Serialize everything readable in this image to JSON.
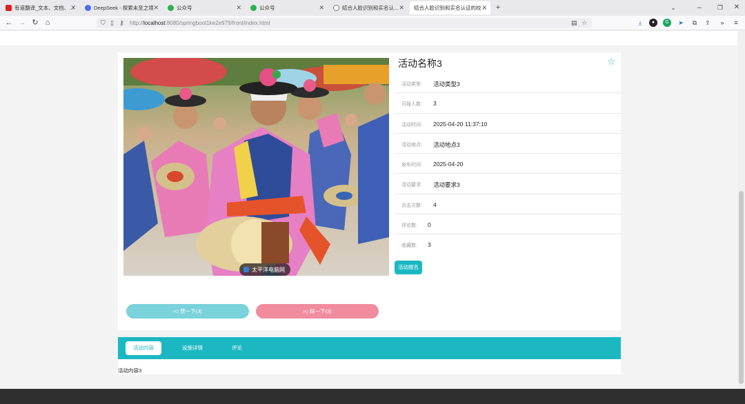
{
  "browser": {
    "tabs": [
      {
        "title": "有道翻译_文本、文档、网页、空",
        "favicon": "#e02020"
      },
      {
        "title": "DeepSeek - 探索未至之境",
        "favicon": "#4d6bfe"
      },
      {
        "title": "公众号",
        "favicon": "#2bb24c"
      },
      {
        "title": "公众号",
        "favicon": "#2bb24c"
      },
      {
        "title": "结合人脸识别和实名认证的校园",
        "favicon": "#777777"
      },
      {
        "title": "结合人脸识别和实名认证的校园论",
        "favicon": "#777777"
      }
    ],
    "new_tab": "+",
    "url_prefix": "http://",
    "url_host": "localhost",
    "url_rest": ":8080/springboot1ke2e979/front/index.html"
  },
  "activity": {
    "title": "活动名称3",
    "fields": [
      {
        "label": "活动类型:",
        "value": "活动类型3"
      },
      {
        "label": "可报人数:",
        "value": "3"
      },
      {
        "label": "活动时间:",
        "value": "2025-04-20 11:37:10"
      },
      {
        "label": "活动地点:",
        "value": "活动地点3"
      },
      {
        "label": "发布时间:",
        "value": "2025-04-20"
      },
      {
        "label": "活动要求:",
        "value": "活动要求3"
      },
      {
        "label": "点击次数:",
        "value": "4"
      },
      {
        "label": "评论数:",
        "value": "0"
      },
      {
        "label": "收藏数:",
        "value": "3"
      }
    ],
    "signup_label": "活动报名",
    "thumb_up_label": "赞一下(3)",
    "thumb_down_label": "踩一下(3)",
    "image_watermark": "太平洋电脑网"
  },
  "content_tabs": [
    {
      "label": "活动内容"
    },
    {
      "label": "设施详情"
    },
    {
      "label": "评论"
    }
  ],
  "content_text": "活动内容3",
  "colors": {
    "accent": "#1bb8c2",
    "thumb_up": "#7ad2da",
    "thumb_down": "#f08c9e"
  }
}
